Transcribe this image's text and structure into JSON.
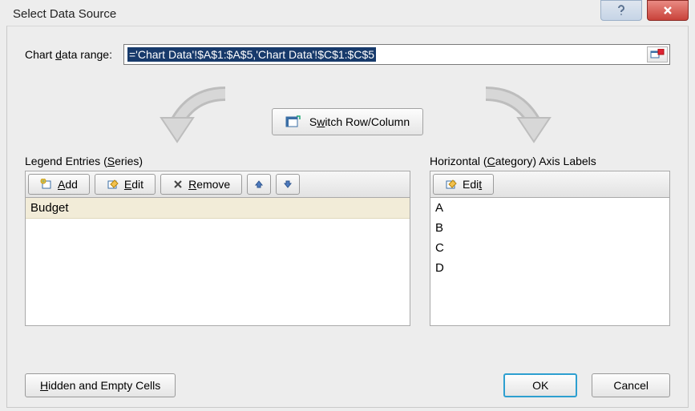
{
  "window": {
    "title": "Select Data Source"
  },
  "range": {
    "label_pre": "Chart ",
    "label_u": "d",
    "label_post": "ata range:",
    "value": "='Chart Data'!$A$1:$A$5,'Chart Data'!$C$1:$C$5"
  },
  "switch": {
    "label_pre": "S",
    "label_u": "w",
    "label_post": "itch Row/Column"
  },
  "legend": {
    "title_pre": "Legend Entries (",
    "title_u": "S",
    "title_post": "eries)",
    "add_u": "A",
    "add_post": "dd",
    "edit_u": "E",
    "edit_post": "dit",
    "remove_u": "R",
    "remove_post": "emove",
    "items": [
      "Budget"
    ]
  },
  "axis": {
    "title_pre": "Horizontal (",
    "title_u": "C",
    "title_post": "ategory) Axis Labels",
    "edit_pre": "Edi",
    "edit_u": "t",
    "items": [
      "A",
      "B",
      "C",
      "D"
    ]
  },
  "bottom": {
    "hidden_u": "H",
    "hidden_post": "idden and Empty Cells",
    "ok": "OK",
    "cancel": "Cancel"
  }
}
